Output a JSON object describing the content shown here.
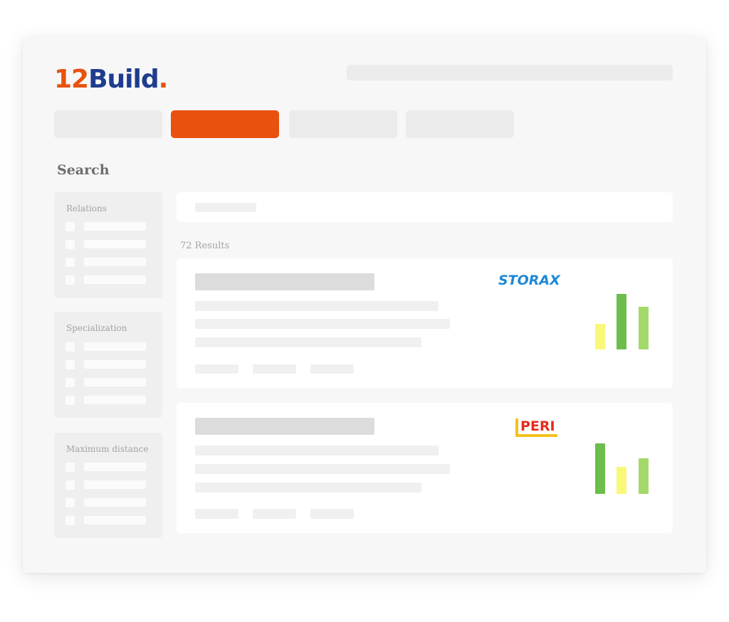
{
  "brand": {
    "logo_main": "12",
    "logo_main2": "Build",
    "logo_dot": "."
  },
  "search": {
    "heading": "Search"
  },
  "filters": [
    {
      "title": "Relations"
    },
    {
      "title": "Specialization"
    },
    {
      "title": "Maximum distance"
    }
  ],
  "results": {
    "count_label": "72 Results",
    "cards": [
      {
        "company_logo_text": "STORAX",
        "chart_values": [
          0.46,
          1.0,
          0.77
        ],
        "chart_colors": [
          "#f9f878",
          "#6cbd4b",
          "#a3d96a"
        ]
      },
      {
        "company_logo_text": "PERI",
        "chart_values": [
          1.0,
          0.53,
          0.71
        ],
        "chart_colors": [
          "#6cbd4b",
          "#f9f878",
          "#a3d96a"
        ]
      }
    ]
  },
  "colors": {
    "accent": "#e8520e",
    "brand_blue": "#1f3d8f",
    "placeholder": "#ebebeb"
  }
}
